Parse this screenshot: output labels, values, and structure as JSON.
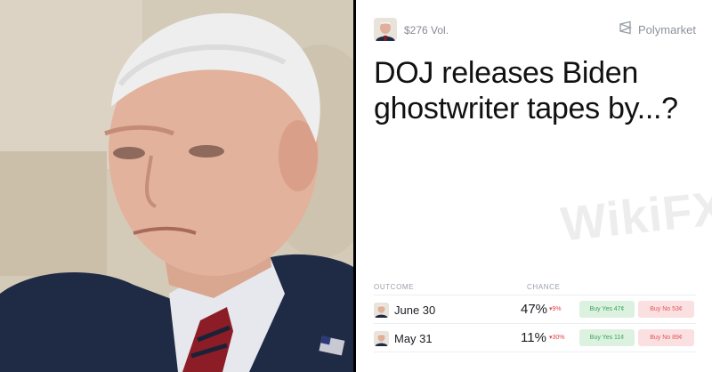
{
  "market": {
    "volume": "$276 Vol.",
    "brand": "Polymarket",
    "title": "DOJ releases Biden ghostwriter tapes by...?",
    "watermark": "WikiFX",
    "columns": {
      "outcome": "OUTCOME",
      "chance": "CHANCE"
    },
    "outcomes": [
      {
        "label": "June 30",
        "chance": "47%",
        "delta": "▾9%",
        "buy_yes": "Buy Yes 47¢",
        "buy_no": "Buy No 53¢"
      },
      {
        "label": "May 31",
        "chance": "11%",
        "delta": "▾30%",
        "buy_yes": "Buy Yes 11¢",
        "buy_no": "Buy No 89¢"
      }
    ]
  },
  "colors": {
    "yes_bg": "#dcf1e0",
    "yes_text": "#3aa55b",
    "no_bg": "#fbe0e1",
    "no_text": "#e0575b",
    "delta_down": "#e0454a"
  },
  "icons": {
    "brand": "polymarket-logo-icon"
  }
}
